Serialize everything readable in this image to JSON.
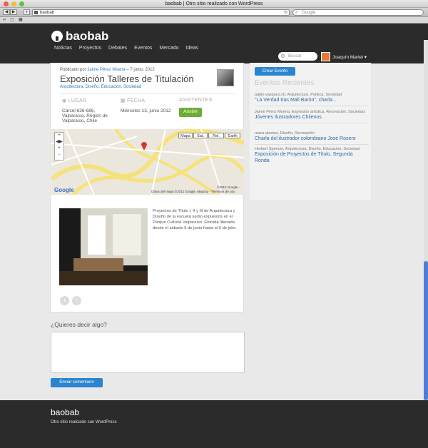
{
  "window": {
    "title": "baobab | Otro sitio realizado con WordPress",
    "url": "baobab",
    "search_placeholder": "Google"
  },
  "header": {
    "logo": "baobab",
    "nav": [
      "Noticias",
      "Proyectos",
      "Debates",
      "Eventos",
      "Mercado",
      "Ideas"
    ],
    "search_placeholder": "Buscar",
    "user": "Joaquín Martel ▾"
  },
  "post": {
    "meta_prefix": "Publicado por",
    "author": "Jaime Pérez Moena",
    "date": "– 7 junio, 2012",
    "title": "Exposición Talleres de Titulación",
    "categories": "Arquitectura, Diseño, Educación, Sociedad",
    "lugar_label": "LUGAR",
    "fecha_label": "FECHA",
    "asistentes_label": "ASISTENTES",
    "lugar_value": "Cárcel 636-686, Valparaíso, Región de Valparaíso, Chile",
    "fecha_value": "Miércoles 13, junio 2012",
    "asistire": "Asistiré",
    "description": "Proyectos de Título I, II y III de Arquitectura y Diseño de la escuela serán expuestos en el Parque Cultural Valparaíso. Entrada liberada desde el sábado 9 de junio hasta el 6 de julio."
  },
  "map": {
    "buttons": [
      "Mapa",
      "Sat.",
      "Rel.",
      "Earth"
    ],
    "google": "Google",
    "copyright": "Datos del mapa ©2012 Google, Mapcity - Términos de uso",
    "copyright2": "©2012 Google -"
  },
  "comment": {
    "heading": "¿Quieres decir algo?",
    "submit": "Enviar comentario"
  },
  "sidebar": {
    "crear": "Crear Evento",
    "heading": "Eventos Recientes",
    "events": [
      {
        "meta": "pablo.vasquez.ch, Arquitectura, Política, Sociedad",
        "title": "\"La Verdad tras Mall Barón\", charla..."
      },
      {
        "meta": "Jaime Pérez Moena, Expresión artística, Recreación, Sociedad",
        "title": "Jóvenes Ilustradores Chilenos"
      },
      {
        "meta": "maca.alamos, Diseño, Recreación",
        "title": "Charla del ilustrador colombiano José Rosero"
      },
      {
        "meta": "Herbert Spencer, Arquitectura, Diseño, Educación, Sociedad",
        "title": "Exposición de Proyectos de Título, Segunda Ronda"
      }
    ]
  },
  "footer": {
    "logo": "baobab",
    "tagline": "Otro sitio realizado con WordPress"
  }
}
